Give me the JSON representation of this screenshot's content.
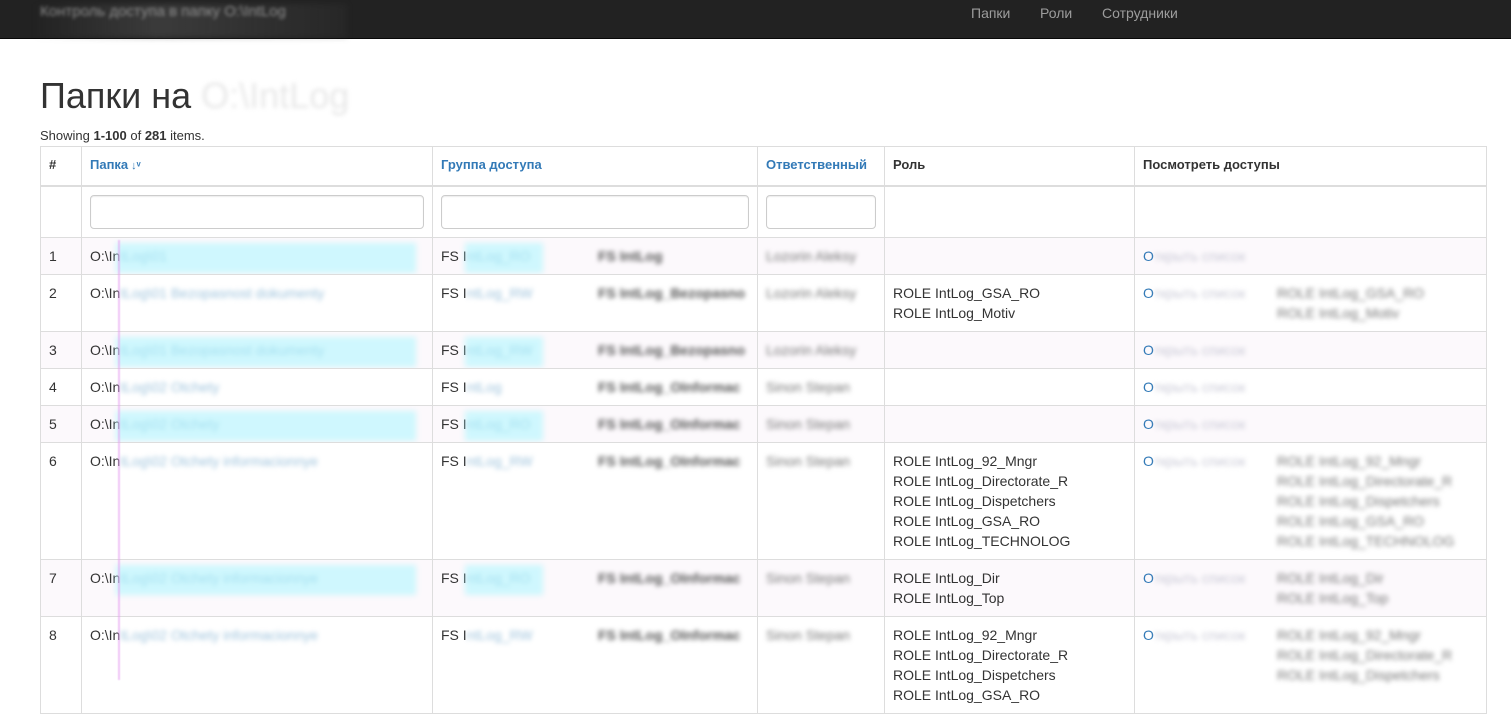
{
  "navbar": {
    "brand": "Контроль доступа в папку O:\\IntLog",
    "items": [
      "Папки",
      "Роли",
      "Сотрудники"
    ]
  },
  "page": {
    "title": "Папки на",
    "title_suffix": "O:\\IntLog",
    "summary_prefix": "Showing ",
    "summary_range": "1-100",
    "summary_of": " of ",
    "summary_total": "281",
    "summary_suffix": " items."
  },
  "table": {
    "columns": [
      "#",
      "Папка",
      "Группа доступа",
      "Ответственный",
      "Роль",
      "Посмотреть доступы"
    ],
    "rows": [
      {
        "num": "1",
        "folder": "O:\\IntLog\\01",
        "group": "FS IntLog_RO",
        "group_name": "FS IntLog",
        "owner": "Lozorin Aleksy",
        "roles": [],
        "view": "Открыть список",
        "view_roles": []
      },
      {
        "num": "2",
        "folder": "O:\\IntLog\\01 Bezopasnost dokumenty",
        "group": "FS IntLog_RW",
        "group_name": "FS IntLog_Bezopasno",
        "owner": "Lozorin Aleksy",
        "roles": [
          "ROLE IntLog_GSA_RO",
          "ROLE IntLog_Motiv"
        ],
        "view": "Открыть список",
        "view_roles": [
          "ROLE IntLog_GSA_RO",
          "ROLE IntLog_Motiv"
        ]
      },
      {
        "num": "3",
        "folder": "O:\\IntLog\\01 Bezopasnost dokumenty",
        "group": "FS IntLog_RW",
        "group_name": "FS IntLog_Bezopasno",
        "owner": "Lozorin Aleksy",
        "roles": [],
        "view": "Открыть список",
        "view_roles": []
      },
      {
        "num": "4",
        "folder": "O:\\IntLog\\02 Otchety",
        "group": "FS IntLog",
        "group_name": "FS IntLog_OInformac",
        "owner": "Sinon Stepan",
        "roles": [],
        "view": "Открыть список",
        "view_roles": []
      },
      {
        "num": "5",
        "folder": "O:\\IntLog\\02 Otchety",
        "group": "FS IntLog_RO",
        "group_name": "FS IntLog_OInformac",
        "owner": "Sinon Stepan",
        "roles": [],
        "view": "Открыть список",
        "view_roles": []
      },
      {
        "num": "6",
        "folder": "O:\\IntLog\\02 Otchety informacionnye",
        "group": "FS IntLog_RW",
        "group_name": "FS IntLog_OInformac",
        "owner": "Sinon Stepan",
        "roles": [
          "ROLE IntLog_92_Mngr",
          "ROLE IntLog_Directorate_R",
          "ROLE IntLog_Dispetchers",
          "ROLE IntLog_GSA_RO",
          "ROLE IntLog_TECHNOLOG"
        ],
        "view": "Открыть список",
        "view_roles": [
          "ROLE IntLog_92_Mngr",
          "ROLE IntLog_Directorate_R",
          "ROLE IntLog_Dispetchers",
          "ROLE IntLog_GSA_RO",
          "ROLE IntLog_TECHNOLOG"
        ]
      },
      {
        "num": "7",
        "folder": "O:\\IntLog\\02 Otchety informacionnye",
        "group": "FS IntLog_RO",
        "group_name": "FS IntLog_OInformac",
        "owner": "Sinon Stepan",
        "roles": [
          "ROLE IntLog_Dir",
          "ROLE IntLog_Top"
        ],
        "view": "Открыть список",
        "view_roles": [
          "ROLE IntLog_Dir",
          "ROLE IntLog_Top"
        ]
      },
      {
        "num": "8",
        "folder": "O:\\IntLog\\02 Otchety informacionnye",
        "group": "FS IntLog_RW",
        "group_name": "FS IntLog_OInformac",
        "owner": "Sinon Stepan",
        "roles": [
          "ROLE IntLog_92_Mngr",
          "ROLE IntLog_Directorate_R",
          "ROLE IntLog_Dispetchers",
          "ROLE IntLog_GSA_RO"
        ],
        "view": "Открыть список",
        "view_roles": [
          "ROLE IntLog_92_Mngr",
          "ROLE IntLog_Directorate_R",
          "ROLE IntLog_Dispetchers"
        ]
      }
    ]
  },
  "colors": {
    "navbar_bg": "#222222",
    "link": "#337ab7",
    "stripe": "#fcf9fc",
    "highlight": "#aaf5ff"
  },
  "icons": {
    "sort": "sort-alpha-icon"
  }
}
